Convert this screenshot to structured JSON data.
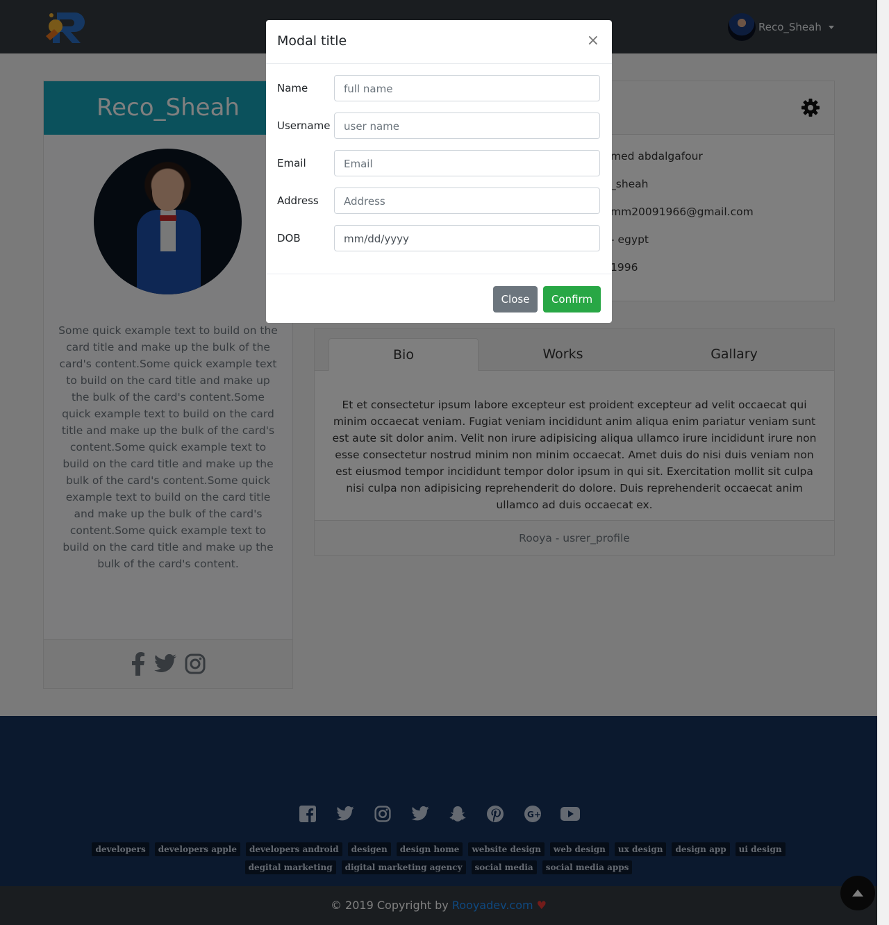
{
  "navbar": {
    "user_name": "Reco_Sheah"
  },
  "left_card": {
    "title": "Reco_Sheah",
    "bio": "Some quick example text to build on the card title and make up the bulk of the card's content.Some quick example text to build on the card title and make up the bulk of the card's content.Some quick example text to build on the card title and make up the bulk of the card's content.Some quick example text to build on the card title and make up the bulk of the card's content.Some quick example text to build on the card title and make up the bulk of the card's content.Some quick example text to build on the card title and make up the bulk of the card's content."
  },
  "info_card": {
    "rows": [
      "med abdalgafour",
      "_sheah",
      "mm20091966@gmail.com",
      "- egypt",
      "1996"
    ]
  },
  "tabs": {
    "items": [
      "Bio",
      "Works",
      "Gallary"
    ],
    "active": "Bio",
    "content": "Et et consectetur ipsum labore excepteur est proident excepteur ad velit occaecat qui minim occaecat veniam. Fugiat veniam incididunt anim aliqua enim pariatur veniam sunt est aute sit dolor anim. Velit non irure adipisicing aliqua ullamco irure incididunt irure non esse consectetur nostrud minim non minim occaecat. Amet duis do nisi duis veniam non est eiusmod tempor incididunt tempor dolor ipsum in qui sit. Exercitation mollit sit culpa nisi culpa non adipisicing reprehenderit do dolore. Duis reprehenderit occaecat anim ullamco ad duis occaecat ex.",
    "footer": "Rooya - usrer_profile"
  },
  "footer": {
    "tags": [
      "developers",
      "developers apple",
      "developers android",
      "desigen",
      "design home",
      "website design",
      "web design",
      "ux design",
      "design app",
      "ui design",
      "degital marketing",
      "digital marketing agency",
      "social media",
      "social media apps"
    ],
    "copyright": "© 2019 Copyright by ",
    "brand": "Rooyadev.com",
    "heart": "♥"
  },
  "modal": {
    "title": "Modal title",
    "close_symbol": "×",
    "fields": [
      {
        "label": "Name",
        "placeholder": "full name"
      },
      {
        "label": "Username",
        "placeholder": "user name"
      },
      {
        "label": "Email",
        "placeholder": "Email"
      },
      {
        "label": "Address",
        "placeholder": "Address"
      },
      {
        "label": "DOB",
        "placeholder": "mm/dd/yyyy"
      }
    ],
    "close_label": "Close",
    "confirm_label": "Confirm"
  },
  "colors": {
    "teal": "#17a2b8",
    "success": "#28a745",
    "secondary": "#6c757d",
    "footer_bg": "#16325c",
    "dark": "#343a40"
  },
  "icons": {
    "card_social": [
      "facebook-icon",
      "twitter-icon",
      "instagram-icon"
    ],
    "footer_social": [
      "facebook-square-icon",
      "twitter-icon",
      "instagram-icon",
      "twitter-icon",
      "snapchat-icon",
      "pinterest-icon",
      "google-plus-icon",
      "youtube-icon"
    ]
  }
}
